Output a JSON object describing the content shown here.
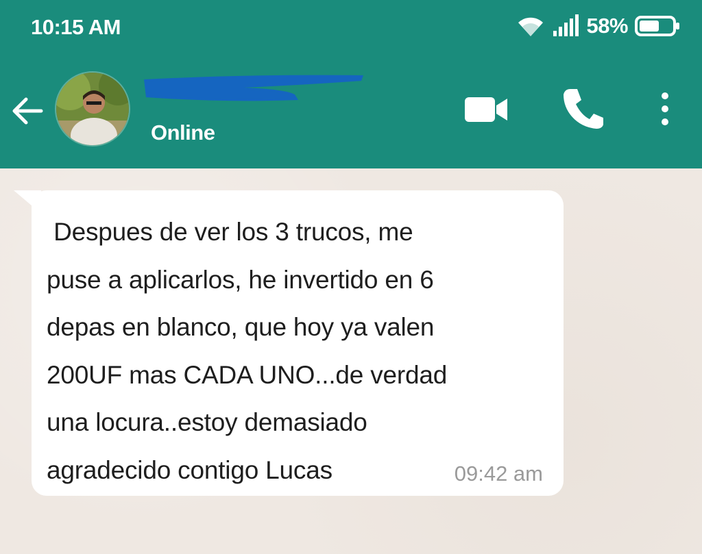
{
  "status_bar": {
    "time": "10:15 AM",
    "battery_percent": "58%",
    "icons": [
      "wifi-icon",
      "signal-icon",
      "battery-icon"
    ]
  },
  "header": {
    "contact_name": "",
    "contact_status": "Online",
    "icons": [
      "back-arrow-icon",
      "video-call-icon",
      "phone-icon",
      "more-vert-icon"
    ]
  },
  "messages": [
    {
      "direction": "incoming",
      "text": " Despues de ver los 3 trucos, me\npuse a aplicarlos, he invertido en 6\ndepas en blanco, que hoy ya valen\n200UF mas CADA UNO...de verdad\nuna locura..estoy demasiado\nagradecido contigo Lucas",
      "time": "09:42 am"
    }
  ],
  "colors": {
    "header_bg": "#1a8c7c",
    "chat_bg": "#efe8e2",
    "bubble_bg": "#ffffff",
    "redaction": "#1565c0"
  }
}
